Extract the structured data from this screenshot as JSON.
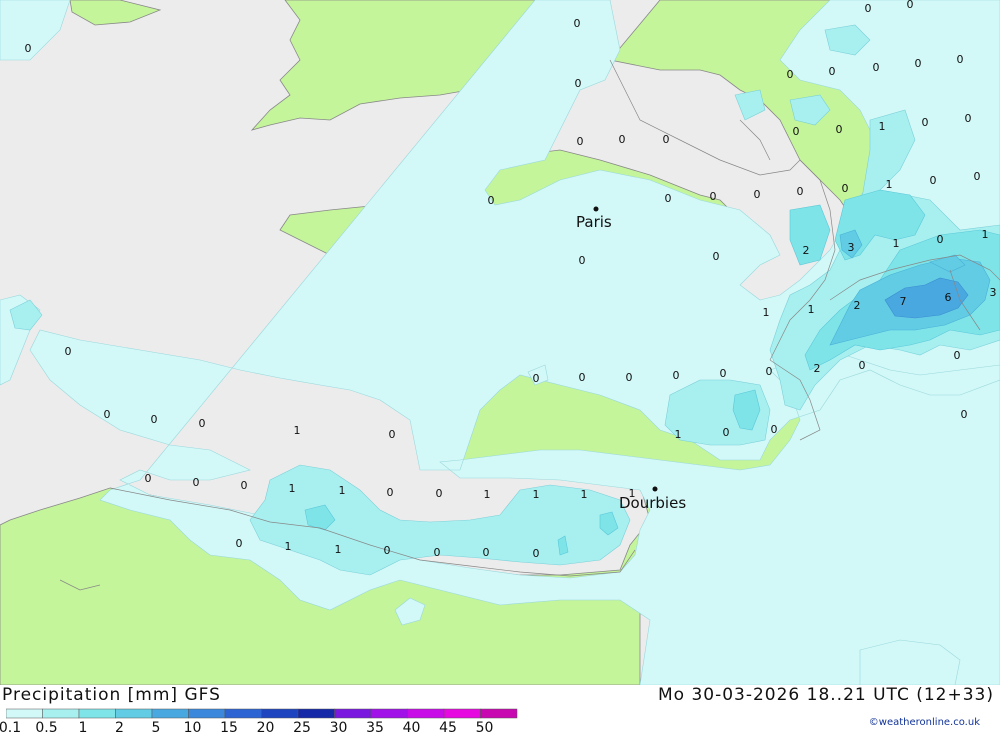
{
  "title": "Precipitation [mm] GFS",
  "datetime": "Mo 30-03-2026 18..21 UTC (12+33)",
  "credit": "©weatheronline.co.uk",
  "colors": {
    "sea": "#ececec",
    "land": "#c4f59a",
    "precip_01": "#d2f8f8",
    "precip_05": "#a8f0f0",
    "precip_1": "#7ee4e8",
    "precip_2": "#62cce4",
    "precip_5": "#4aa8e0"
  },
  "legend": {
    "ticks": [
      "0.1",
      "0.5",
      "1",
      "2",
      "5",
      "10",
      "15",
      "20",
      "25",
      "30",
      "35",
      "40",
      "45",
      "50"
    ],
    "colors": [
      "#d2f8f8",
      "#a8f0f0",
      "#7ee4e8",
      "#62cce4",
      "#4aa8e0",
      "#3c88dc",
      "#2c64d4",
      "#1e44c0",
      "#1428a8",
      "#7a18e0",
      "#a012e8",
      "#c80ce8",
      "#e60ae0",
      "#c808b0"
    ]
  },
  "cities": [
    {
      "name": "Paris"
    },
    {
      "name": "Dourbies"
    }
  ],
  "labels": [
    {
      "v": "0"
    },
    {
      "v": "0"
    },
    {
      "v": "0"
    },
    {
      "v": "0"
    },
    {
      "v": "0"
    },
    {
      "v": "0"
    },
    {
      "v": "0"
    },
    {
      "v": "0"
    },
    {
      "v": "0"
    },
    {
      "v": "0"
    },
    {
      "v": "0"
    },
    {
      "v": "1"
    },
    {
      "v": "0"
    },
    {
      "v": "0"
    },
    {
      "v": "0"
    },
    {
      "v": "0"
    },
    {
      "v": "0"
    },
    {
      "v": "0"
    },
    {
      "v": "0"
    },
    {
      "v": "0"
    },
    {
      "v": "1"
    },
    {
      "v": "0"
    },
    {
      "v": "0"
    },
    {
      "v": "0"
    },
    {
      "v": "0"
    },
    {
      "v": "2"
    },
    {
      "v": "3"
    },
    {
      "v": "1"
    },
    {
      "v": "0"
    },
    {
      "v": "1"
    },
    {
      "v": "1"
    },
    {
      "v": "1"
    },
    {
      "v": "2"
    },
    {
      "v": "7"
    },
    {
      "v": "6"
    },
    {
      "v": "3"
    },
    {
      "v": "0"
    },
    {
      "v": "0"
    },
    {
      "v": "0"
    },
    {
      "v": "0"
    },
    {
      "v": "0"
    },
    {
      "v": "0"
    },
    {
      "v": "0"
    },
    {
      "v": "2"
    },
    {
      "v": "0"
    },
    {
      "v": "0"
    },
    {
      "v": "0"
    },
    {
      "v": "0"
    },
    {
      "v": "0"
    },
    {
      "v": "0"
    },
    {
      "v": "1"
    },
    {
      "v": "0"
    },
    {
      "v": "0"
    },
    {
      "v": "0"
    },
    {
      "v": "0"
    },
    {
      "v": "0"
    },
    {
      "v": "0"
    },
    {
      "v": "1"
    },
    {
      "v": "0"
    },
    {
      "v": "0"
    },
    {
      "v": "0"
    },
    {
      "v": "0"
    },
    {
      "v": "1"
    },
    {
      "v": "1"
    },
    {
      "v": "0"
    },
    {
      "v": "0"
    },
    {
      "v": "1"
    },
    {
      "v": "1"
    },
    {
      "v": "1"
    },
    {
      "v": "1"
    },
    {
      "v": "0"
    },
    {
      "v": "1"
    },
    {
      "v": "1"
    },
    {
      "v": "0"
    },
    {
      "v": "0"
    },
    {
      "v": "0"
    },
    {
      "v": "0"
    }
  ]
}
